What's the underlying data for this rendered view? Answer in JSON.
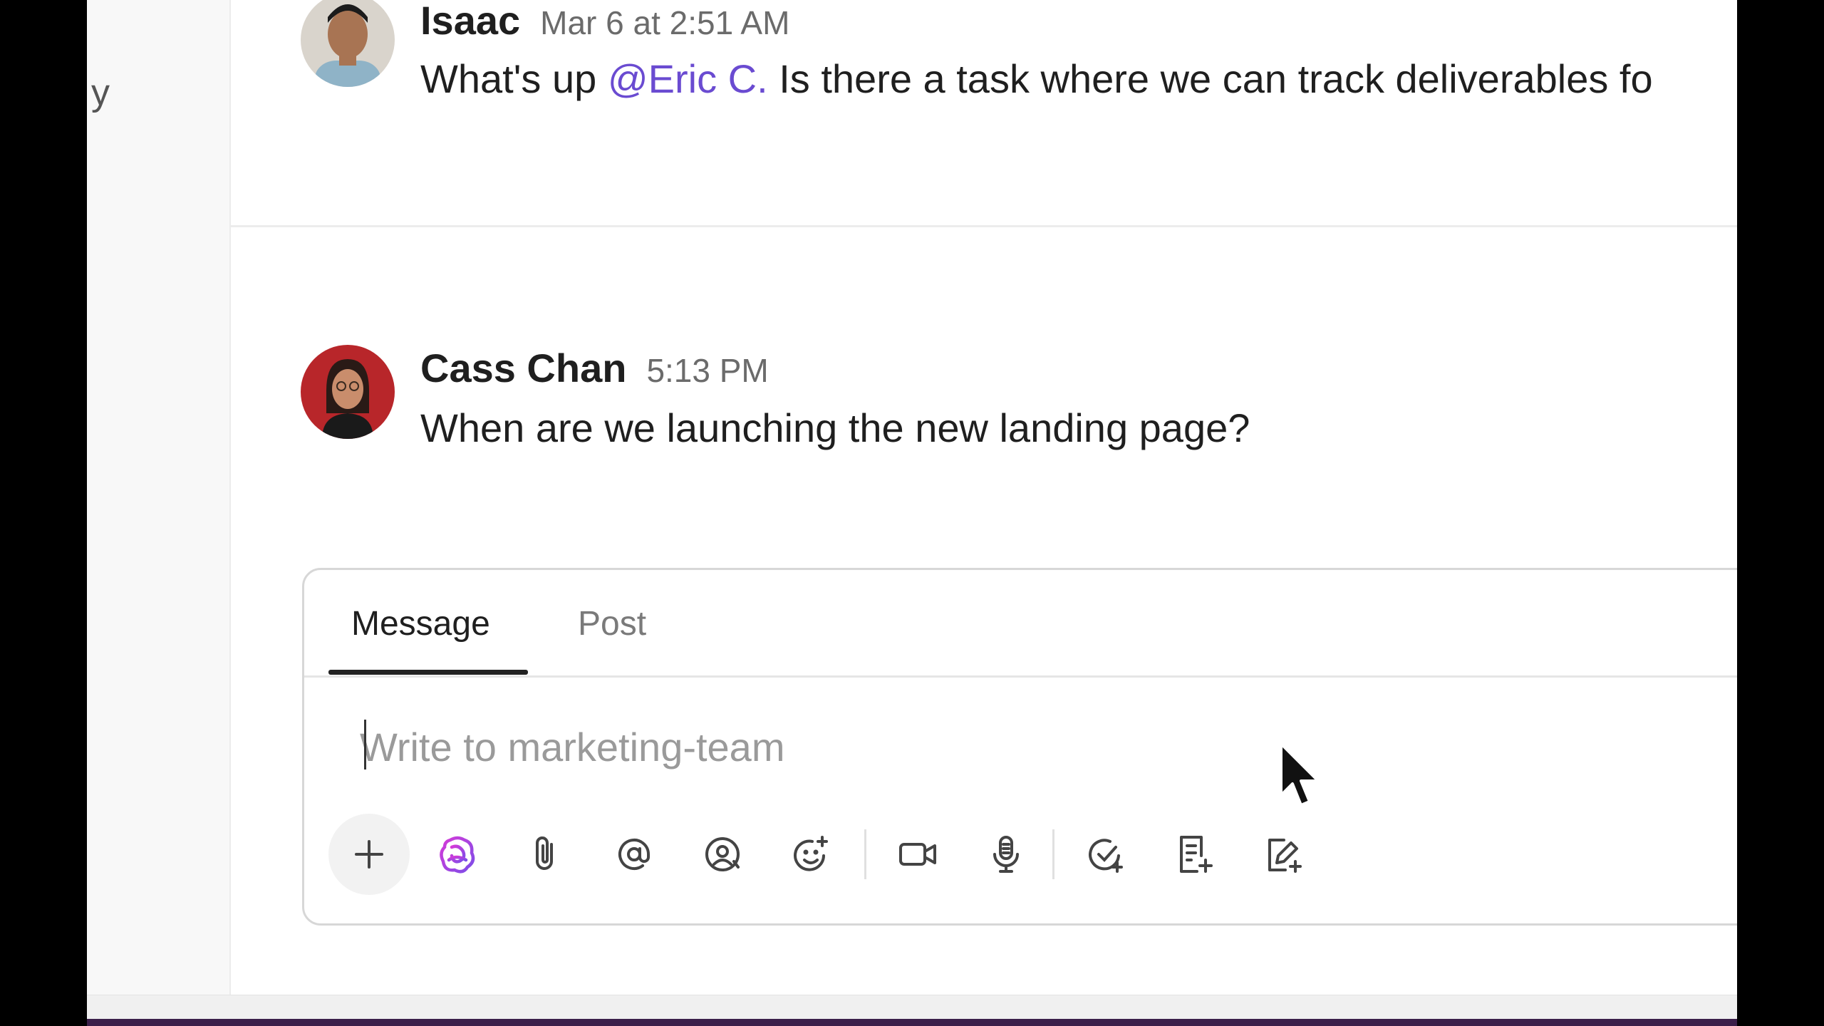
{
  "left_panel": {
    "fragment": "y"
  },
  "messages": [
    {
      "author": "Isaac",
      "time": "Mar 6 at 2:51 AM",
      "text_before": "What's up ",
      "mention": "@Eric C.",
      "text_after": " Is there a task where we can track deliverables fo"
    },
    {
      "author": "Cass Chan",
      "time": "5:13 PM",
      "text": "When are we launching the new landing page?"
    }
  ],
  "composer": {
    "tabs": [
      {
        "label": "Message",
        "active": true
      },
      {
        "label": "Post",
        "active": false
      }
    ],
    "placeholder": "Write to marketing-team",
    "value": "",
    "tools": [
      {
        "icon": "plus-icon"
      },
      {
        "icon": "ai-brain-icon"
      },
      {
        "icon": "paperclip-icon"
      },
      {
        "icon": "at-mention-icon"
      },
      {
        "icon": "mention-person-icon"
      },
      {
        "icon": "emoji-add-icon"
      },
      {
        "icon": "video-clip-icon"
      },
      {
        "icon": "microphone-icon"
      },
      {
        "icon": "task-check-add-icon"
      },
      {
        "icon": "doc-add-icon"
      },
      {
        "icon": "whiteboard-add-icon"
      }
    ]
  },
  "colors": {
    "mention": "#6a4bd1",
    "ai_icon_gradient": [
      "#d63ad8",
      "#7b4de8"
    ],
    "background": "#ffffff",
    "frame": "#000000"
  }
}
